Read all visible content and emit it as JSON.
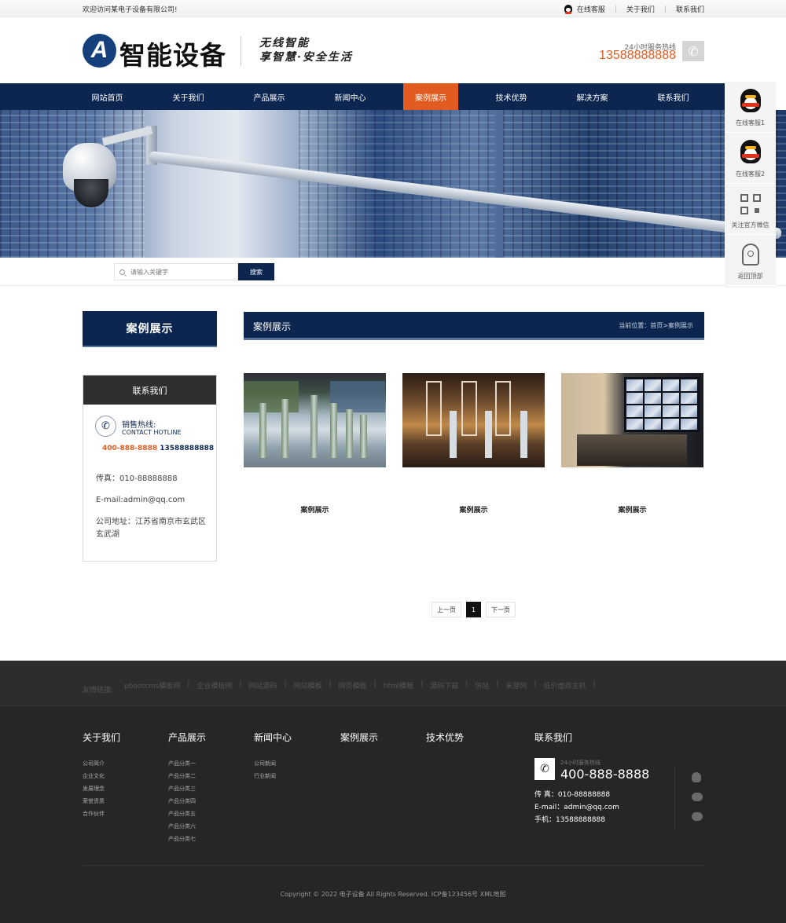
{
  "topbar": {
    "welcome": "欢迎访问某电子设备有限公司!",
    "online_service": "在线客服",
    "about": "关于我们",
    "contact": "联系我们"
  },
  "header": {
    "logo_letter": "A",
    "logo_text": "智能设备",
    "slogan_line1": "无线智能",
    "slogan_line2": "享智慧·安全生活",
    "hotline_label": "24小时服务热线",
    "hotline_number": "13588888888"
  },
  "nav": {
    "items": [
      "网站首页",
      "关于我们",
      "产品展示",
      "新闻中心",
      "案例展示",
      "技术优势",
      "解决方案",
      "联系我们"
    ],
    "active_index": 4
  },
  "float_bar": {
    "items": [
      "在线客服1",
      "在线客服2",
      "关注官方微信",
      "返回顶部"
    ]
  },
  "search": {
    "placeholder": "请输入关键字",
    "button": "搜索"
  },
  "sidebar": {
    "title": "案例展示",
    "contact_title": "联系我们",
    "hotline_title": "销售热线:",
    "hotline_sub": "CONTACT HOTLINE",
    "hotline_num1": "400-888-8888",
    "hotline_num2": "13588888888",
    "fax": "传真：010-88888888",
    "email": "E-mail:admin@qq.com",
    "address": "公司地址：江苏省南京市玄武区玄武湖"
  },
  "main": {
    "title": "案例展示",
    "breadcrumb": "当前位置：首页>案例展示",
    "cases": [
      {
        "caption": "案例展示",
        "image": "store-security-gates"
      },
      {
        "caption": "案例展示",
        "image": "shop-entrance-gates"
      },
      {
        "caption": "案例展示",
        "image": "monitoring-control-room"
      }
    ],
    "pagination": {
      "prev": "上一页",
      "current": "1",
      "next": "下一页"
    }
  },
  "footer": {
    "friends_label": "友情链接:",
    "friends": [
      "pbootcms模板网",
      "企业模板网",
      "网站源码",
      "网站模板",
      "网页模板",
      "html模板",
      "源码下载",
      "仿站",
      "米芽网",
      "低价虚拟主机"
    ],
    "columns": [
      {
        "title": "关于我们",
        "items": [
          "公司简介",
          "企业文化",
          "发展理念",
          "荣誉资质",
          "合作伙伴"
        ]
      },
      {
        "title": "产品展示",
        "items": [
          "产品分类一",
          "产品分类二",
          "产品分类三",
          "产品分类四",
          "产品分类五",
          "产品分类六",
          "产品分类七"
        ]
      },
      {
        "title": "新闻中心",
        "items": [
          "公司新闻",
          "行业新闻"
        ]
      },
      {
        "title": "案例展示",
        "items": []
      },
      {
        "title": "技术优势",
        "items": []
      }
    ],
    "contact_title": "联系我们",
    "hotline_label": "24小时服务热线",
    "hotline": "400-888-8888",
    "fax": "传  真：010-88888888",
    "email": "E-mail：admin@qq.com",
    "mobile": "手机：13588888888",
    "copyright": "Copyright © 2022 电子设备 All Rights Reserved.    ICP备123456号 XML地图"
  }
}
